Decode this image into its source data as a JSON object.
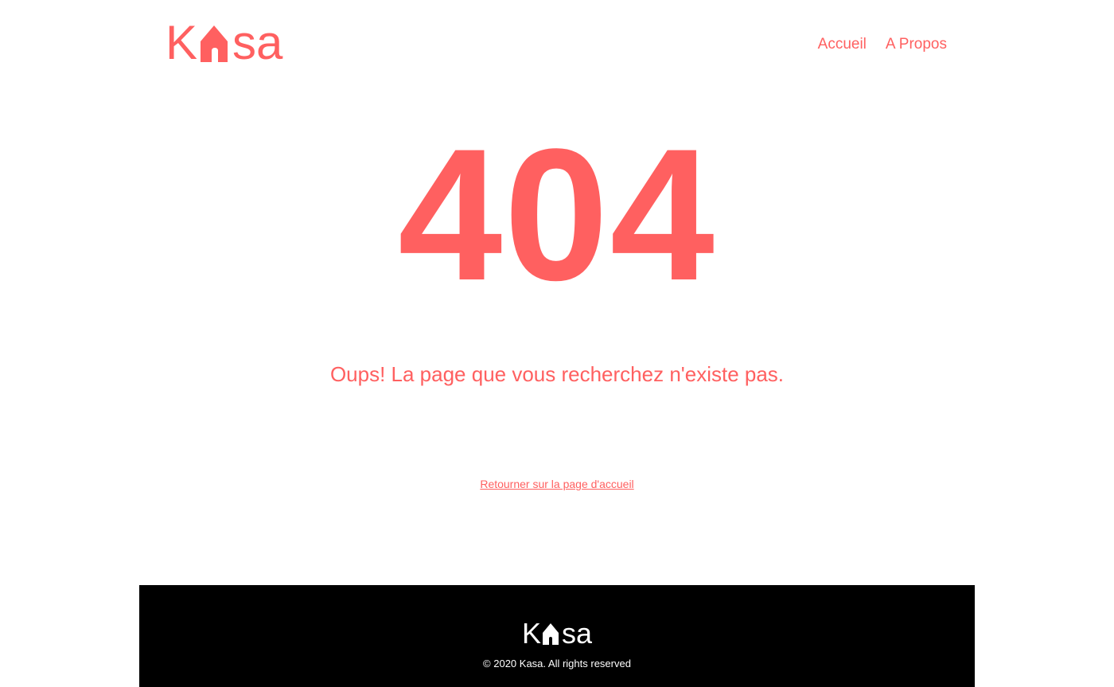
{
  "brand": {
    "letters": [
      "K",
      "s",
      "a"
    ],
    "accent_color": "#FF6060",
    "footer_color": "#FFFFFF"
  },
  "nav": {
    "items": [
      {
        "label": "Accueil"
      },
      {
        "label": "A Propos"
      }
    ]
  },
  "error": {
    "code": "404",
    "message": "Oups! La page que vous recherchez n'existe pas.",
    "back_link": "Retourner sur la page d'accueil"
  },
  "footer": {
    "background": "#000000",
    "copyright": "© 2020 Kasa. All rights reserved"
  }
}
